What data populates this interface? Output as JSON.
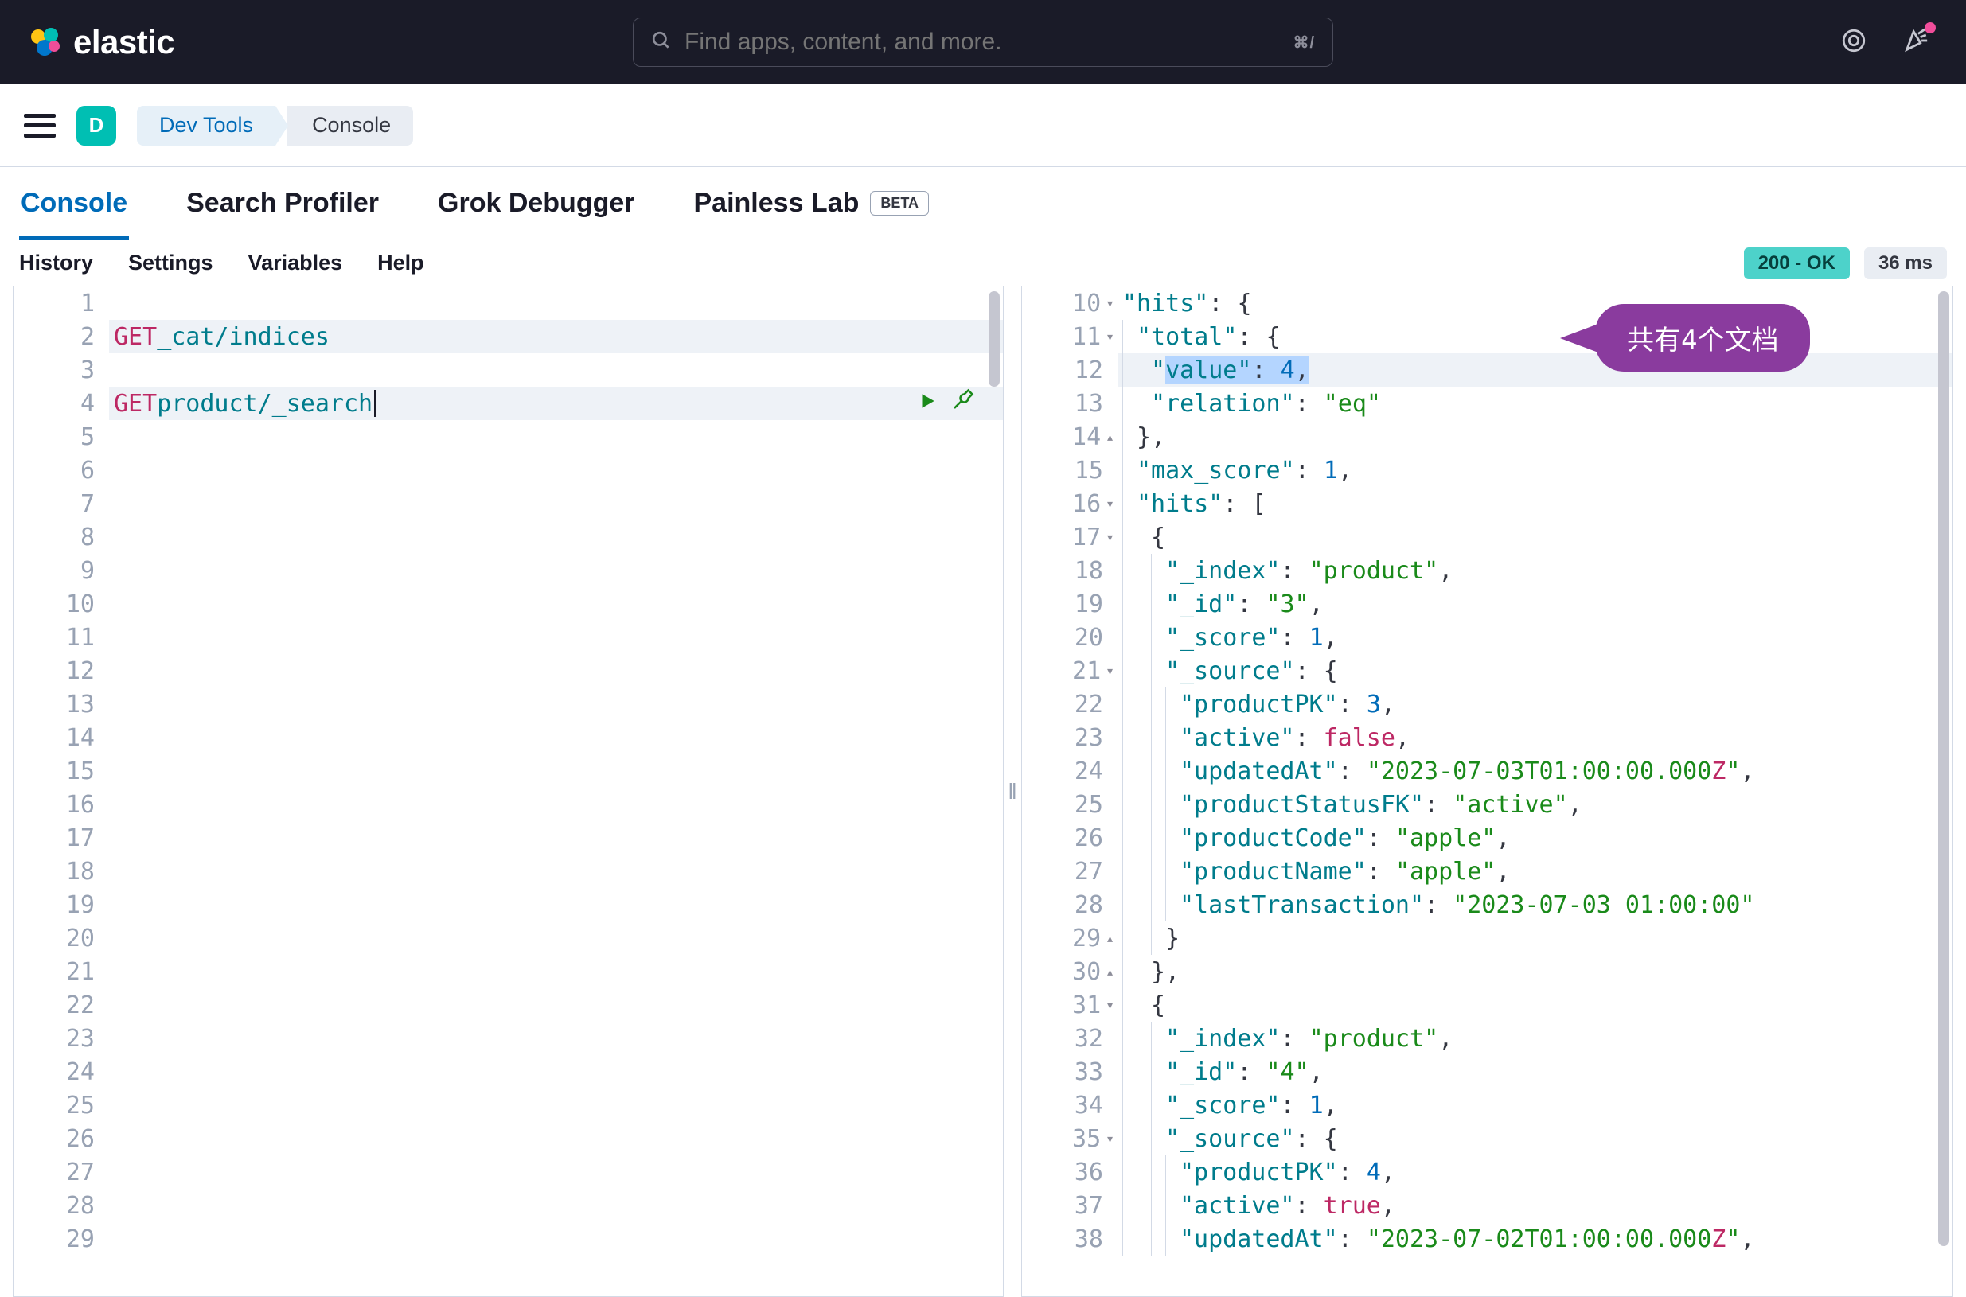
{
  "header": {
    "logo_text": "elastic",
    "search_placeholder": "Find apps, content, and more.",
    "search_kbd": "⌘/"
  },
  "breadcrumb": {
    "space_letter": "D",
    "item1": "Dev Tools",
    "item2": "Console"
  },
  "tabs": {
    "console": "Console",
    "profiler": "Search Profiler",
    "grok": "Grok Debugger",
    "painless": "Painless Lab",
    "beta": "BETA"
  },
  "subnav": {
    "history": "History",
    "settings": "Settings",
    "variables": "Variables",
    "help": "Help"
  },
  "status": {
    "code_text": "200 - OK",
    "time_text": "36 ms"
  },
  "request": {
    "lines": [
      {
        "n": 1,
        "text": ""
      },
      {
        "n": 2,
        "method": "GET",
        "path": "_cat/indices"
      },
      {
        "n": 3,
        "text": ""
      },
      {
        "n": 4,
        "method": "GET",
        "path": "product/_search",
        "active": true
      },
      {
        "n": 5
      },
      {
        "n": 6
      },
      {
        "n": 7
      },
      {
        "n": 8
      },
      {
        "n": 9
      },
      {
        "n": 10
      },
      {
        "n": 11
      },
      {
        "n": 12
      },
      {
        "n": 13
      },
      {
        "n": 14
      },
      {
        "n": 15
      },
      {
        "n": 16
      },
      {
        "n": 17
      },
      {
        "n": 18
      },
      {
        "n": 19
      },
      {
        "n": 20
      },
      {
        "n": 21
      },
      {
        "n": 22
      },
      {
        "n": 23
      },
      {
        "n": 24
      },
      {
        "n": 25
      },
      {
        "n": 26
      },
      {
        "n": 27
      },
      {
        "n": 28
      },
      {
        "n": 29
      }
    ]
  },
  "response_start": 10,
  "response_tokens": [
    {
      "n": 10,
      "fold": "▾",
      "t": [
        {
          "c": "key",
          "v": "\"hits\""
        },
        {
          "c": "punc",
          "v": ": {"
        }
      ]
    },
    {
      "n": 11,
      "fold": "▾",
      "t": [
        {
          "c": "ind",
          "v": 1
        },
        {
          "c": "key",
          "v": "\"total\""
        },
        {
          "c": "punc",
          "v": ": {"
        }
      ]
    },
    {
      "n": 12,
      "hl": true,
      "t": [
        {
          "c": "ind",
          "v": 2
        },
        {
          "c": "key",
          "v": "\"",
          "sel": false
        },
        {
          "c": "selkey",
          "v": "value\""
        },
        {
          "c": "selp",
          "v": ": "
        },
        {
          "c": "selnum",
          "v": "4"
        },
        {
          "c": "selp",
          "v": ","
        }
      ]
    },
    {
      "n": 13,
      "t": [
        {
          "c": "ind",
          "v": 2
        },
        {
          "c": "key",
          "v": "\"relation\""
        },
        {
          "c": "punc",
          "v": ": "
        },
        {
          "c": "str",
          "v": "\"eq\""
        }
      ]
    },
    {
      "n": 14,
      "fold": "▴",
      "t": [
        {
          "c": "ind",
          "v": 1
        },
        {
          "c": "punc",
          "v": "},"
        }
      ]
    },
    {
      "n": 15,
      "t": [
        {
          "c": "ind",
          "v": 1
        },
        {
          "c": "key",
          "v": "\"max_score\""
        },
        {
          "c": "punc",
          "v": ": "
        },
        {
          "c": "num",
          "v": "1"
        },
        {
          "c": "punc",
          "v": ","
        }
      ]
    },
    {
      "n": 16,
      "fold": "▾",
      "t": [
        {
          "c": "ind",
          "v": 1
        },
        {
          "c": "key",
          "v": "\"hits\""
        },
        {
          "c": "punc",
          "v": ": ["
        }
      ]
    },
    {
      "n": 17,
      "fold": "▾",
      "t": [
        {
          "c": "ind",
          "v": 2
        },
        {
          "c": "punc",
          "v": "{"
        }
      ]
    },
    {
      "n": 18,
      "t": [
        {
          "c": "ind",
          "v": 3
        },
        {
          "c": "key",
          "v": "\"_index\""
        },
        {
          "c": "punc",
          "v": ": "
        },
        {
          "c": "str",
          "v": "\"product\""
        },
        {
          "c": "punc",
          "v": ","
        }
      ]
    },
    {
      "n": 19,
      "t": [
        {
          "c": "ind",
          "v": 3
        },
        {
          "c": "key",
          "v": "\"_id\""
        },
        {
          "c": "punc",
          "v": ": "
        },
        {
          "c": "str",
          "v": "\"3\""
        },
        {
          "c": "punc",
          "v": ","
        }
      ]
    },
    {
      "n": 20,
      "t": [
        {
          "c": "ind",
          "v": 3
        },
        {
          "c": "key",
          "v": "\"_score\""
        },
        {
          "c": "punc",
          "v": ": "
        },
        {
          "c": "num",
          "v": "1"
        },
        {
          "c": "punc",
          "v": ","
        }
      ]
    },
    {
      "n": 21,
      "fold": "▾",
      "t": [
        {
          "c": "ind",
          "v": 3
        },
        {
          "c": "key",
          "v": "\"_source\""
        },
        {
          "c": "punc",
          "v": ": {"
        }
      ]
    },
    {
      "n": 22,
      "t": [
        {
          "c": "ind",
          "v": 4
        },
        {
          "c": "key",
          "v": "\"productPK\""
        },
        {
          "c": "punc",
          "v": ": "
        },
        {
          "c": "num",
          "v": "3"
        },
        {
          "c": "punc",
          "v": ","
        }
      ]
    },
    {
      "n": 23,
      "t": [
        {
          "c": "ind",
          "v": 4
        },
        {
          "c": "key",
          "v": "\"active\""
        },
        {
          "c": "punc",
          "v": ": "
        },
        {
          "c": "bool",
          "v": "false"
        },
        {
          "c": "punc",
          "v": ","
        }
      ]
    },
    {
      "n": 24,
      "t": [
        {
          "c": "ind",
          "v": 4
        },
        {
          "c": "key",
          "v": "\"updatedAt\""
        },
        {
          "c": "punc",
          "v": ": "
        },
        {
          "c": "str",
          "v": "\"2023-07-03T01:00:00.000"
        },
        {
          "c": "z",
          "v": "Z"
        },
        {
          "c": "str",
          "v": "\""
        },
        {
          "c": "punc",
          "v": ","
        }
      ]
    },
    {
      "n": 25,
      "t": [
        {
          "c": "ind",
          "v": 4
        },
        {
          "c": "key",
          "v": "\"productStatusFK\""
        },
        {
          "c": "punc",
          "v": ": "
        },
        {
          "c": "str",
          "v": "\"active\""
        },
        {
          "c": "punc",
          "v": ","
        }
      ]
    },
    {
      "n": 26,
      "t": [
        {
          "c": "ind",
          "v": 4
        },
        {
          "c": "key",
          "v": "\"productCode\""
        },
        {
          "c": "punc",
          "v": ": "
        },
        {
          "c": "str",
          "v": "\"apple\""
        },
        {
          "c": "punc",
          "v": ","
        }
      ]
    },
    {
      "n": 27,
      "t": [
        {
          "c": "ind",
          "v": 4
        },
        {
          "c": "key",
          "v": "\"productName\""
        },
        {
          "c": "punc",
          "v": ": "
        },
        {
          "c": "str",
          "v": "\"apple\""
        },
        {
          "c": "punc",
          "v": ","
        }
      ]
    },
    {
      "n": 28,
      "t": [
        {
          "c": "ind",
          "v": 4
        },
        {
          "c": "key",
          "v": "\"lastTransaction\""
        },
        {
          "c": "punc",
          "v": ": "
        },
        {
          "c": "str",
          "v": "\"2023-07-03 01:00:00\""
        }
      ]
    },
    {
      "n": 29,
      "fold": "▴",
      "t": [
        {
          "c": "ind",
          "v": 3
        },
        {
          "c": "punc",
          "v": "}"
        }
      ]
    },
    {
      "n": 30,
      "fold": "▴",
      "t": [
        {
          "c": "ind",
          "v": 2
        },
        {
          "c": "punc",
          "v": "},"
        }
      ]
    },
    {
      "n": 31,
      "fold": "▾",
      "t": [
        {
          "c": "ind",
          "v": 2
        },
        {
          "c": "punc",
          "v": "{"
        }
      ]
    },
    {
      "n": 32,
      "t": [
        {
          "c": "ind",
          "v": 3
        },
        {
          "c": "key",
          "v": "\"_index\""
        },
        {
          "c": "punc",
          "v": ": "
        },
        {
          "c": "str",
          "v": "\"product\""
        },
        {
          "c": "punc",
          "v": ","
        }
      ]
    },
    {
      "n": 33,
      "t": [
        {
          "c": "ind",
          "v": 3
        },
        {
          "c": "key",
          "v": "\"_id\""
        },
        {
          "c": "punc",
          "v": ": "
        },
        {
          "c": "str",
          "v": "\"4\""
        },
        {
          "c": "punc",
          "v": ","
        }
      ]
    },
    {
      "n": 34,
      "t": [
        {
          "c": "ind",
          "v": 3
        },
        {
          "c": "key",
          "v": "\"_score\""
        },
        {
          "c": "punc",
          "v": ": "
        },
        {
          "c": "num",
          "v": "1"
        },
        {
          "c": "punc",
          "v": ","
        }
      ]
    },
    {
      "n": 35,
      "fold": "▾",
      "t": [
        {
          "c": "ind",
          "v": 3
        },
        {
          "c": "key",
          "v": "\"_source\""
        },
        {
          "c": "punc",
          "v": ": {"
        }
      ]
    },
    {
      "n": 36,
      "t": [
        {
          "c": "ind",
          "v": 4
        },
        {
          "c": "key",
          "v": "\"productPK\""
        },
        {
          "c": "punc",
          "v": ": "
        },
        {
          "c": "num",
          "v": "4"
        },
        {
          "c": "punc",
          "v": ","
        }
      ]
    },
    {
      "n": 37,
      "t": [
        {
          "c": "ind",
          "v": 4
        },
        {
          "c": "key",
          "v": "\"active\""
        },
        {
          "c": "punc",
          "v": ": "
        },
        {
          "c": "bool",
          "v": "true"
        },
        {
          "c": "punc",
          "v": ","
        }
      ]
    },
    {
      "n": 38,
      "t": [
        {
          "c": "ind",
          "v": 4
        },
        {
          "c": "key",
          "v": "\"updatedAt\""
        },
        {
          "c": "punc",
          "v": ": "
        },
        {
          "c": "str",
          "v": "\"2023-07-02T01:00:00.000"
        },
        {
          "c": "z",
          "v": "Z"
        },
        {
          "c": "str",
          "v": "\""
        },
        {
          "c": "punc",
          "v": ","
        }
      ]
    }
  ],
  "callout_text": "共有4个文档"
}
